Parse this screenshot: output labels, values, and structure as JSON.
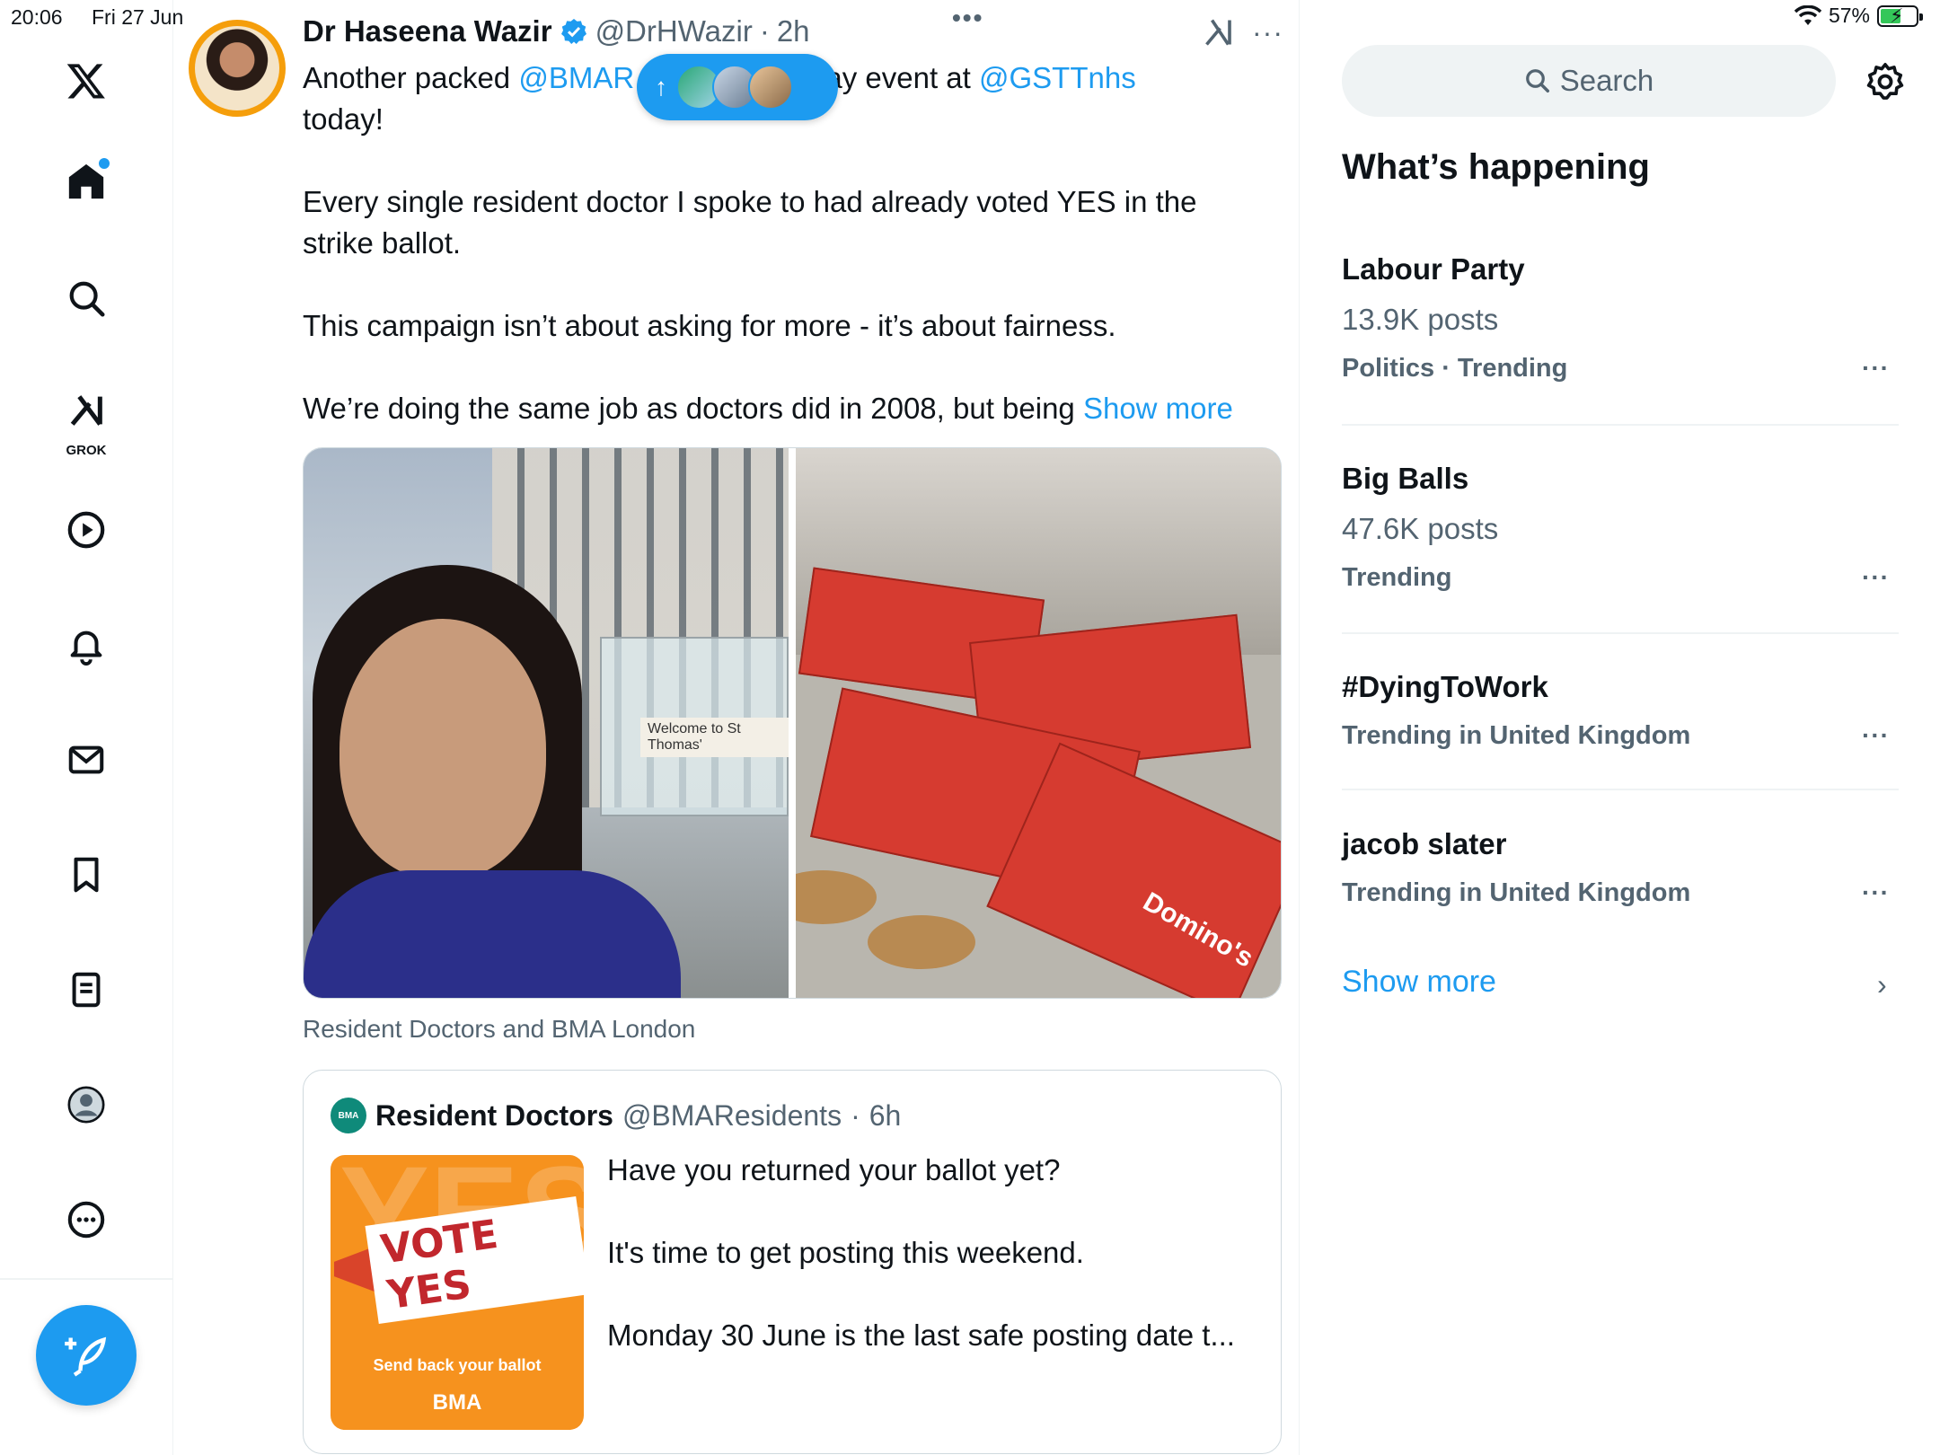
{
  "status_bar": {
    "time": "20:06",
    "date": "Fri 27 Jun",
    "battery": "57%",
    "battery_level": 0.57
  },
  "nav": {
    "items": [
      {
        "name": "x-logo-icon"
      },
      {
        "name": "home-icon",
        "has_notification": true
      },
      {
        "name": "search-icon"
      },
      {
        "name": "grok-icon",
        "label": "GROK"
      },
      {
        "name": "video-icon"
      },
      {
        "name": "notifications-icon"
      },
      {
        "name": "messages-icon"
      },
      {
        "name": "bookmarks-icon"
      },
      {
        "name": "lists-icon"
      },
      {
        "name": "profile-icon"
      },
      {
        "name": "more-icon"
      }
    ],
    "compose": "compose-icon"
  },
  "tweet": {
    "name": "Dr Haseena Wazir",
    "handle": "@DrHWazir",
    "time": "2h",
    "text_start": "Another packed ",
    "mention1": "@BMAR",
    "text_mid": "& Pay event at ",
    "mention2": "@GSTTnhs",
    "line2": "today!",
    "para2": "Every single resident doctor I spoke to had already voted YES in the strike ballot.",
    "para3": "This campaign isn’t about asking for more - it’s about fairness.",
    "para4": "We’re doing the same job as doctors did in 2008, but being ",
    "show_more": "Show more",
    "media_caption": "Resident Doctors and BMA London",
    "photo_sign": "Welcome to St Thomas'",
    "photo_box_label": "Domino's"
  },
  "quote": {
    "avatar_text": "BMA",
    "name": "Resident Doctors",
    "handle": "@BMAResidents",
    "time": "6h",
    "p1": "Have you returned your ballot yet?",
    "p2": "It's time to get posting this weekend.",
    "p3": "Monday 30 June is the last safe posting date t...",
    "image": {
      "vote": "VOTE YES",
      "bg": "YES",
      "send": "Send back your ballot",
      "logo": "BMA"
    }
  },
  "sidebar": {
    "search_placeholder": "Search",
    "section_title": "What’s happening",
    "trends": [
      {
        "title": "Labour Party",
        "posts": "13.9K posts",
        "category": "Politics · Trending"
      },
      {
        "title": "Big Balls",
        "posts": "47.6K posts",
        "category": "Trending"
      },
      {
        "title": "#DyingToWork",
        "posts": "",
        "category": "Trending in United Kingdom"
      },
      {
        "title": "jacob slater",
        "posts": "",
        "category": "Trending in United Kingdom"
      }
    ],
    "show_more": "Show more"
  },
  "colors": {
    "accent": "#1d9bf0",
    "text": "#0f1419",
    "secondary": "#536471",
    "border": "#eff3f4"
  }
}
